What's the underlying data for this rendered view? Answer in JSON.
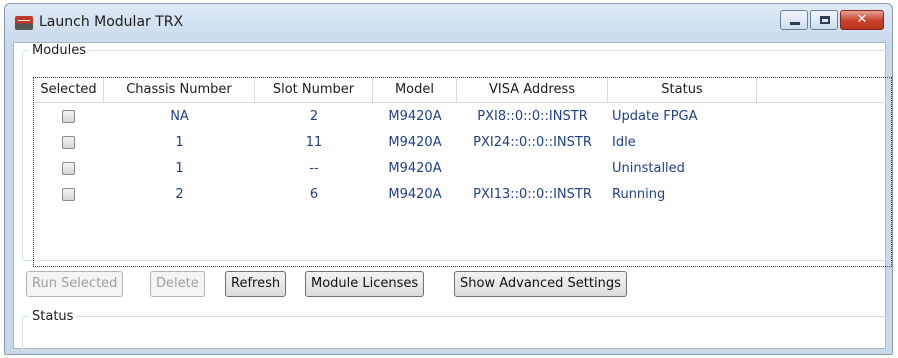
{
  "window": {
    "title": "Launch Modular TRX",
    "close_glyph": "✕"
  },
  "modules": {
    "legend": "Modules",
    "columns": [
      "Selected",
      "Chassis Number",
      "Slot Number",
      "Model",
      "VISA Address",
      "Status"
    ],
    "rows": [
      {
        "chassis": "NA",
        "slot": "2",
        "model": "M9420A",
        "visa": "PXI8::0::0::INSTR",
        "status": "Update FPGA"
      },
      {
        "chassis": "1",
        "slot": "11",
        "model": "M9420A",
        "visa": "PXI24::0::0::INSTR",
        "status": "Idle"
      },
      {
        "chassis": "1",
        "slot": "--",
        "model": "M9420A",
        "visa": "",
        "status": "Uninstalled"
      },
      {
        "chassis": "2",
        "slot": "6",
        "model": "M9420A",
        "visa": "PXI13::0::0::INSTR",
        "status": "Running"
      }
    ]
  },
  "buttons": {
    "run_selected": "Run Selected",
    "delete": "Delete",
    "refresh": "Refresh",
    "module_licenses": "Module Licenses",
    "show_advanced": "Show Advanced Settings"
  },
  "status_panel": {
    "legend": "Status"
  },
  "colors": {
    "cell_text": "#1f3f88",
    "close_button": "#c7402b"
  }
}
